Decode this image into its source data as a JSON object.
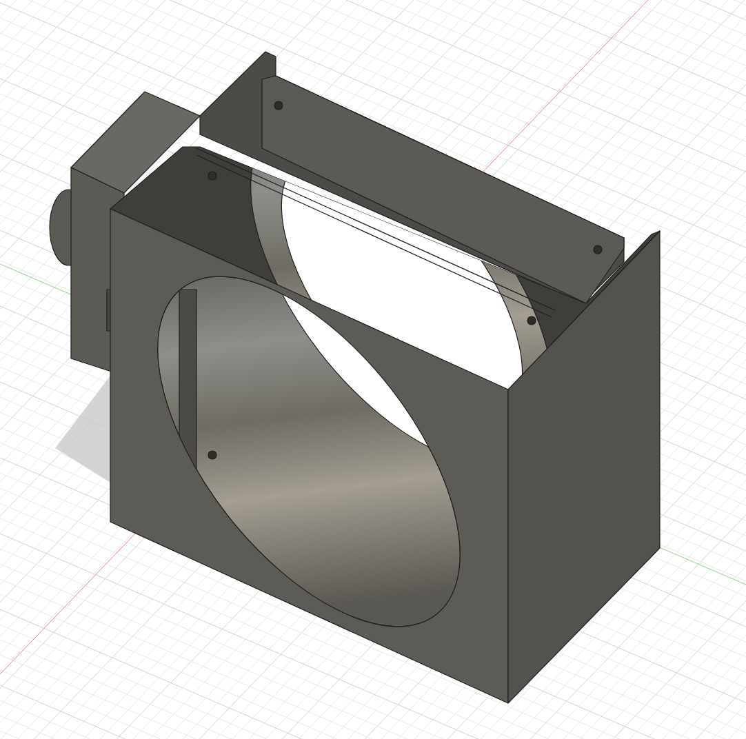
{
  "viewport": {
    "grid": true,
    "axes": true,
    "shadow": true
  }
}
